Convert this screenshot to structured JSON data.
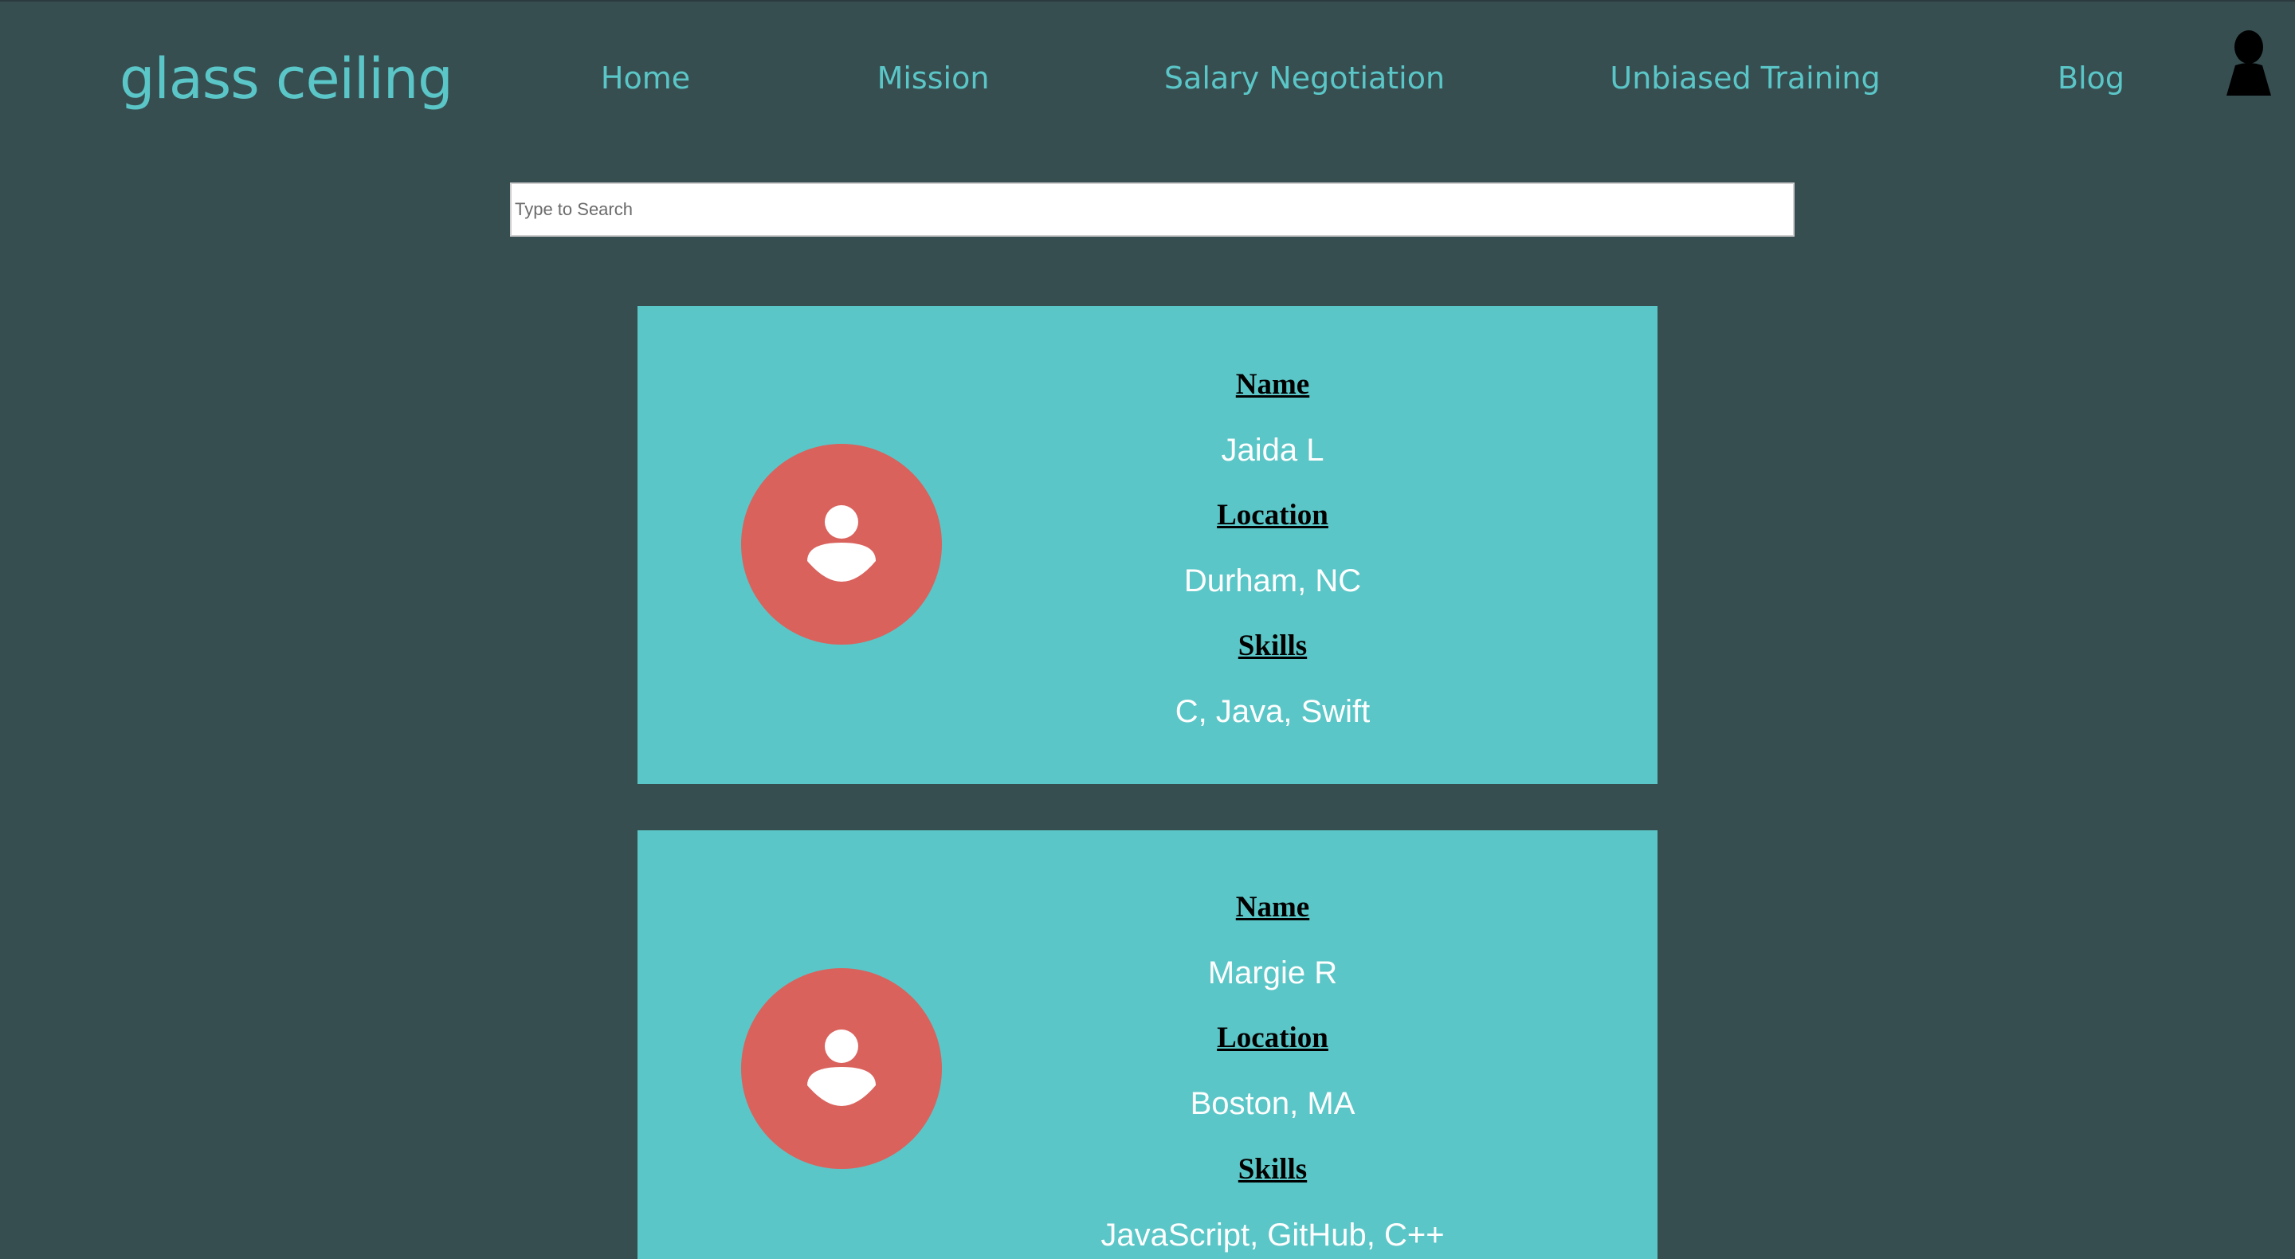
{
  "brand": {
    "logo_text": "glass ceiling",
    "accent_color": "#5bc6c7",
    "background_color": "#374e51"
  },
  "nav": {
    "items": [
      {
        "label": "Home"
      },
      {
        "label": "Mission"
      },
      {
        "label": "Salary Negotiation"
      },
      {
        "label": "Unbiased Training"
      },
      {
        "label": "Blog"
      }
    ],
    "account_icon": "user-silhouette-icon"
  },
  "search": {
    "placeholder": "Type to Search",
    "value": ""
  },
  "profiles": {
    "labels": {
      "name": "Name",
      "location": "Location",
      "skills": "Skills"
    },
    "avatar_icon": "person-icon",
    "avatar_color": "#d9625d",
    "card_color": "#5bc6c7",
    "items": [
      {
        "name": "Jaida L",
        "location": "Durham, NC",
        "skills": "C, Java, Swift"
      },
      {
        "name": "Margie R",
        "location": "Boston, MA",
        "skills": "JavaScript, GitHub, C++"
      }
    ]
  }
}
